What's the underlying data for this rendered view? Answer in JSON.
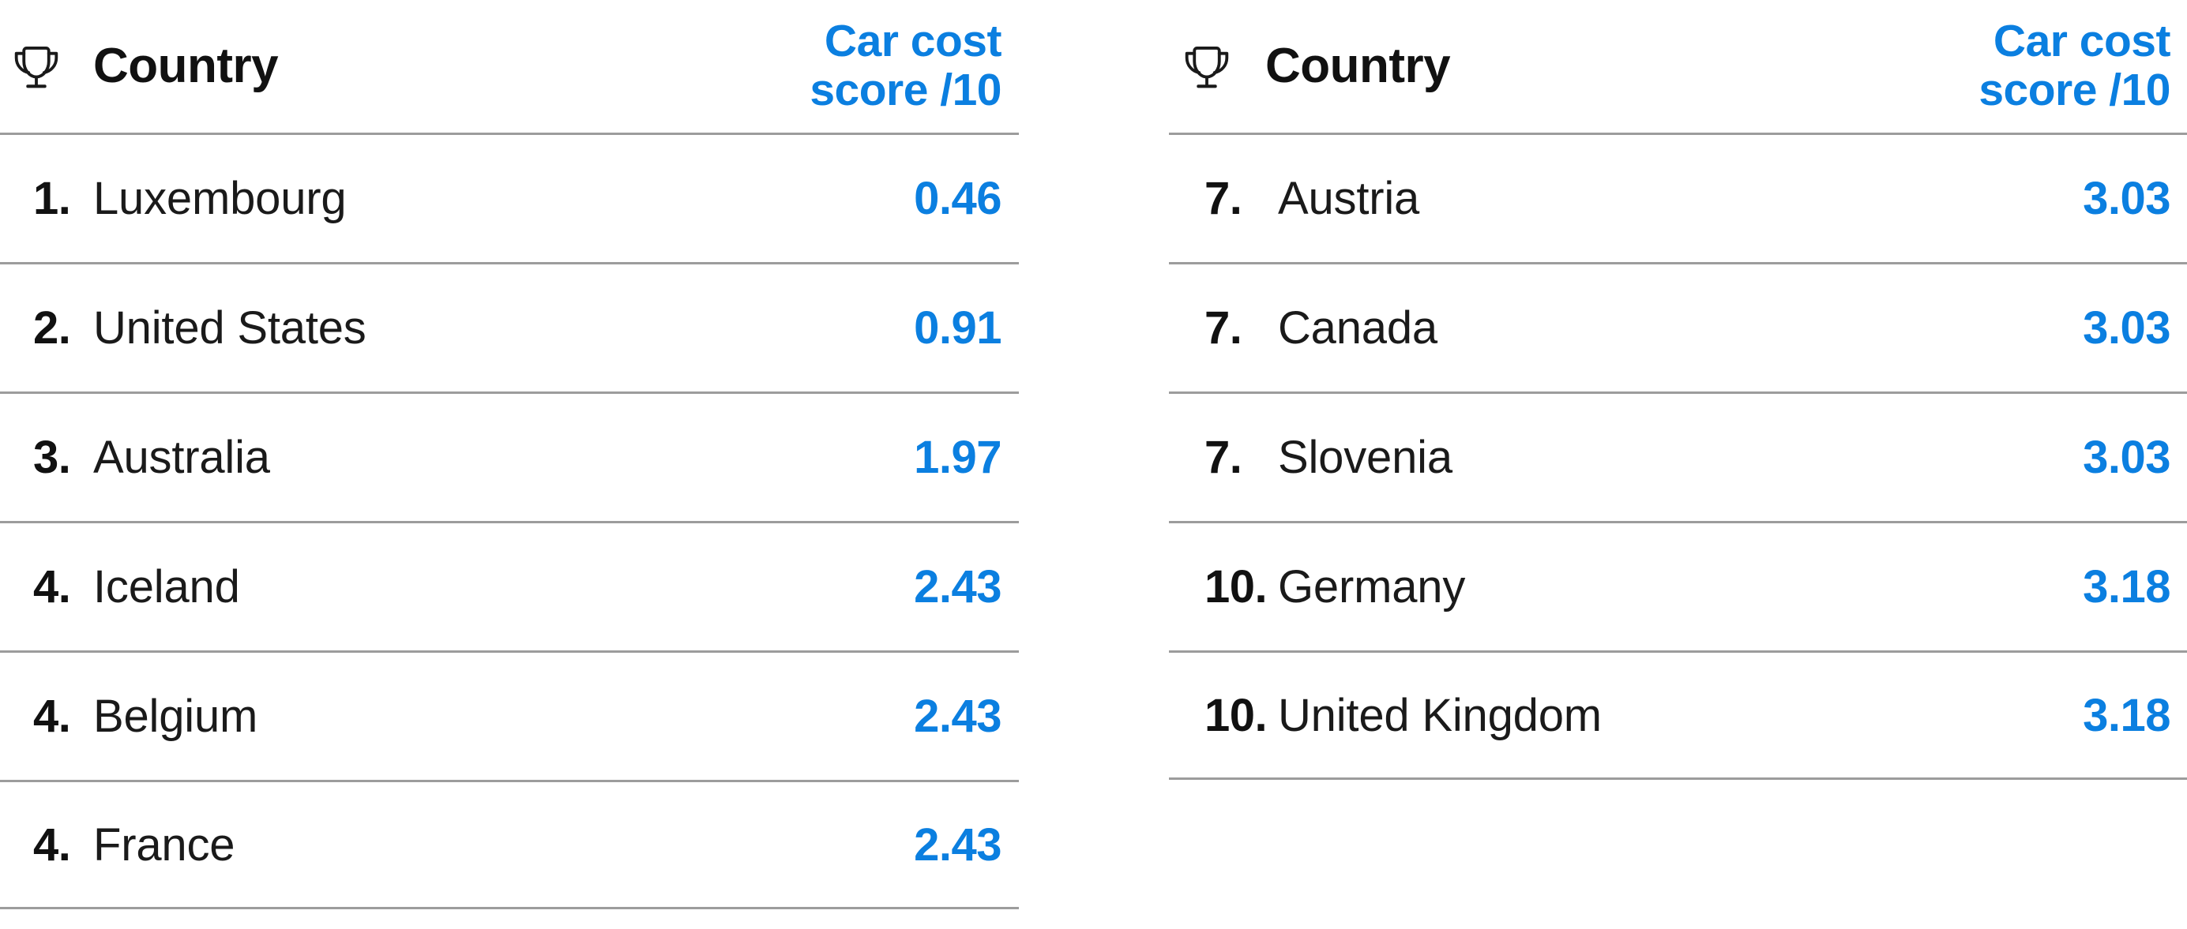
{
  "theme": {
    "accent_color": "#0b7fe0",
    "divider_color": "#9c9c9c",
    "text_color": "#111111",
    "background_color": "#ffffff"
  },
  "icons": {
    "trophy": "trophy-icon"
  },
  "tables": [
    {
      "id": "left",
      "header": {
        "country_label": "Country",
        "score_label_line1": "Car cost",
        "score_label_line2": "score /10"
      },
      "rows": [
        {
          "rank": "1.",
          "country": "Luxembourg",
          "score": "0.46"
        },
        {
          "rank": "2.",
          "country": "United States",
          "score": "0.91"
        },
        {
          "rank": "3.",
          "country": "Australia",
          "score": "1.97"
        },
        {
          "rank": "4.",
          "country": "Iceland",
          "score": "2.43"
        },
        {
          "rank": "4.",
          "country": "Belgium",
          "score": "2.43"
        },
        {
          "rank": "4.",
          "country": "France",
          "score": "2.43"
        }
      ]
    },
    {
      "id": "right",
      "header": {
        "country_label": "Country",
        "score_label_line1": "Car cost",
        "score_label_line2": "score /10"
      },
      "rows": [
        {
          "rank": "7.",
          "country": "Austria",
          "score": "3.03"
        },
        {
          "rank": "7.",
          "country": "Canada",
          "score": "3.03"
        },
        {
          "rank": "7.",
          "country": "Slovenia",
          "score": "3.03"
        },
        {
          "rank": "10.",
          "country": "Germany",
          "score": "3.18"
        },
        {
          "rank": "10.",
          "country": "United Kingdom",
          "score": "3.18"
        }
      ]
    }
  ],
  "chart_data": {
    "type": "table",
    "title": "Car cost score /10",
    "columns": [
      "Rank",
      "Country",
      "Car cost score /10"
    ],
    "categories": [
      "Luxembourg",
      "United States",
      "Australia",
      "Iceland",
      "Belgium",
      "France",
      "Austria",
      "Canada",
      "Slovenia",
      "Germany",
      "United Kingdom"
    ],
    "values": [
      0.46,
      0.91,
      1.97,
      2.43,
      2.43,
      2.43,
      3.03,
      3.03,
      3.03,
      3.18,
      3.18
    ],
    "ranks": [
      1,
      2,
      3,
      4,
      4,
      4,
      7,
      7,
      7,
      10,
      10
    ],
    "xlabel": "Country",
    "ylabel": "Car cost score /10",
    "ylim": [
      0,
      10
    ]
  }
}
